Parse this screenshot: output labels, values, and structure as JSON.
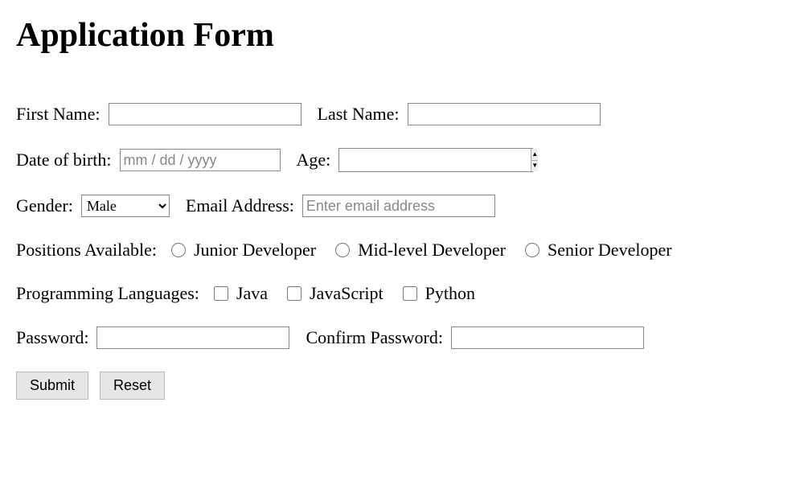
{
  "title": "Application Form",
  "fields": {
    "firstName": {
      "label": "First Name:",
      "value": ""
    },
    "lastName": {
      "label": "Last Name:",
      "value": ""
    },
    "dob": {
      "label": "Date of birth:",
      "placeholder": "mm / dd / yyyy",
      "value": ""
    },
    "age": {
      "label": "Age:",
      "value": ""
    },
    "gender": {
      "label": "Gender:",
      "selected": "Male"
    },
    "email": {
      "label": "Email Address:",
      "placeholder": "Enter email address",
      "value": ""
    },
    "positions": {
      "label": "Positions Available:",
      "options": [
        "Junior Developer",
        "Mid-level Developer",
        "Senior Developer"
      ]
    },
    "languages": {
      "label": "Programming Languages:",
      "options": [
        "Java",
        "JavaScript",
        "Python"
      ]
    },
    "password": {
      "label": "Password:",
      "value": ""
    },
    "confirmPassword": {
      "label": "Confirm Password:",
      "value": ""
    }
  },
  "buttons": {
    "submit": "Submit",
    "reset": "Reset"
  }
}
